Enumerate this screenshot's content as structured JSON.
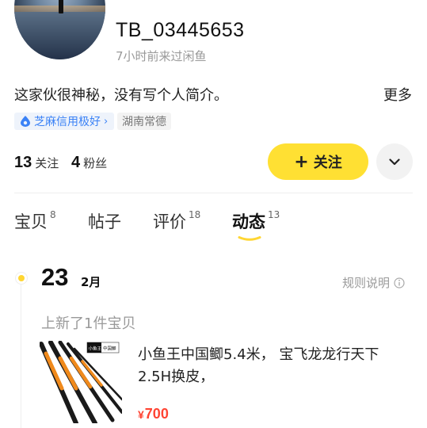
{
  "profile": {
    "username": "TB_03445653",
    "last_seen": "7小时前来过闲鱼",
    "bio": "这家伙很神秘，没有写个人简介。",
    "more_label": "更多",
    "credit_badge": "芝麻信用极好",
    "location": "湖南常德"
  },
  "stats": {
    "following_count": "13",
    "following_label": "关注",
    "followers_count": "4",
    "followers_label": "粉丝"
  },
  "actions": {
    "follow_plus": "+",
    "follow_label": "关注"
  },
  "tabs": [
    {
      "label": "宝贝",
      "count": "8"
    },
    {
      "label": "帖子",
      "count": ""
    },
    {
      "label": "评价",
      "count": "18"
    },
    {
      "label": "动态",
      "count": "13"
    }
  ],
  "active_tab": "动态",
  "feed": {
    "day": "23",
    "month": "2月",
    "rules_label": "规则说明",
    "entry_title": "上新了1件宝贝",
    "product": {
      "title": "小鱼王中国鲫5.4米， 宝飞龙龙行天下2.5H换皮，",
      "currency": "¥",
      "price": "700",
      "image_label_brand": "小鱼王",
      "image_label_model": "中国鲫"
    }
  },
  "colors": {
    "accent_yellow": "#ffe033",
    "price_red": "#ff4433",
    "credit_blue": "#3b82f6"
  }
}
